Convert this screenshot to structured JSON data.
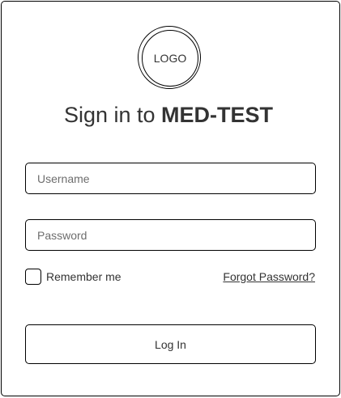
{
  "logo": {
    "text": "LOGO"
  },
  "heading": {
    "prefix": "Sign in to ",
    "brand": "MED-TEST"
  },
  "form": {
    "username_placeholder": "Username",
    "username_value": "",
    "password_placeholder": "Password",
    "password_value": "",
    "remember_label": "Remember me",
    "remember_checked": false,
    "forgot_label": "Forgot Password?",
    "login_label": "Log In"
  }
}
